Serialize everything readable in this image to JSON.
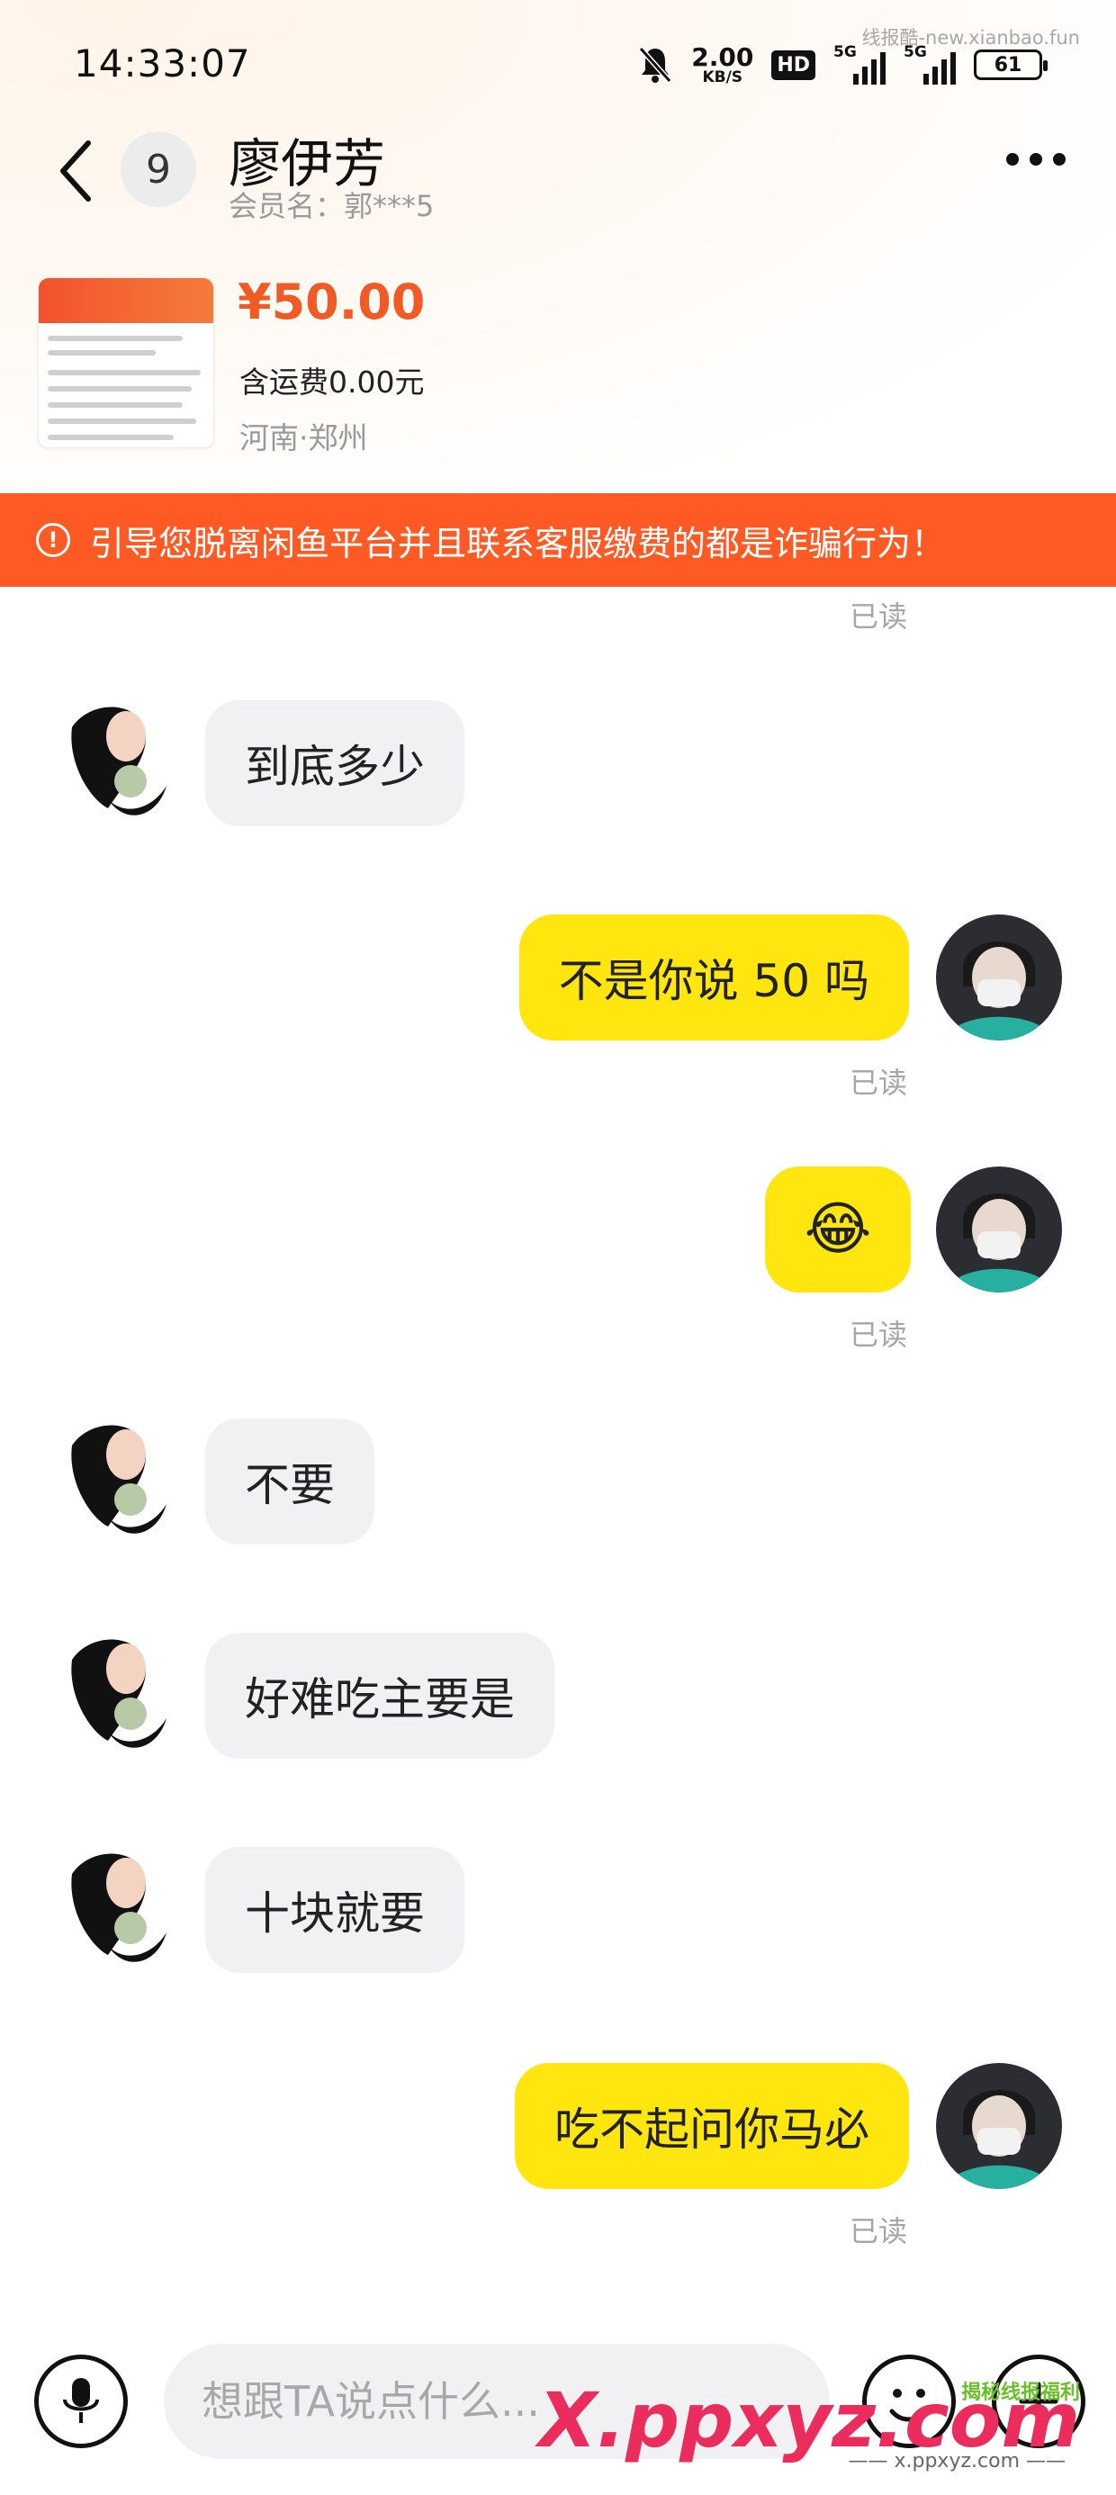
{
  "status_bar": {
    "time": "14:33:07",
    "watermark": "线报酷-new.xianbao.fun",
    "net_speed": "2.00",
    "net_unit": "KB/S",
    "hd": "HD",
    "signal1": "5G",
    "signal2": "5G",
    "battery": "61"
  },
  "header": {
    "unread_count": "9",
    "name": "廖伊芳",
    "member": "会员名：郭***5"
  },
  "product": {
    "price": "¥50.00",
    "shipping": "含运费0.00元",
    "location": "河南·郑州"
  },
  "warning": {
    "text": "引导您脱离闲鱼平台并且联系客服缴费的都是诈骗行为！"
  },
  "messages": [
    {
      "read": "已读"
    },
    {
      "from": "seller",
      "text": "到底多少"
    },
    {
      "from": "me",
      "text": "不是你说 50 吗",
      "read": "已读"
    },
    {
      "from": "me",
      "emoji": "😂",
      "read": "已读"
    },
    {
      "from": "seller",
      "text": "不要"
    },
    {
      "from": "seller",
      "text": "好难吃主要是"
    },
    {
      "from": "seller",
      "text": "十块就要"
    },
    {
      "from": "me",
      "text": "吃不起问你马必",
      "read": "已读"
    }
  ],
  "input": {
    "placeholder": "想跟TA说点什么..."
  },
  "watermark_bottom": {
    "logo": "X.ppxyz.com",
    "sub": "—— x.ppxyz.com ——",
    "tag": "揭秘线报福利"
  }
}
